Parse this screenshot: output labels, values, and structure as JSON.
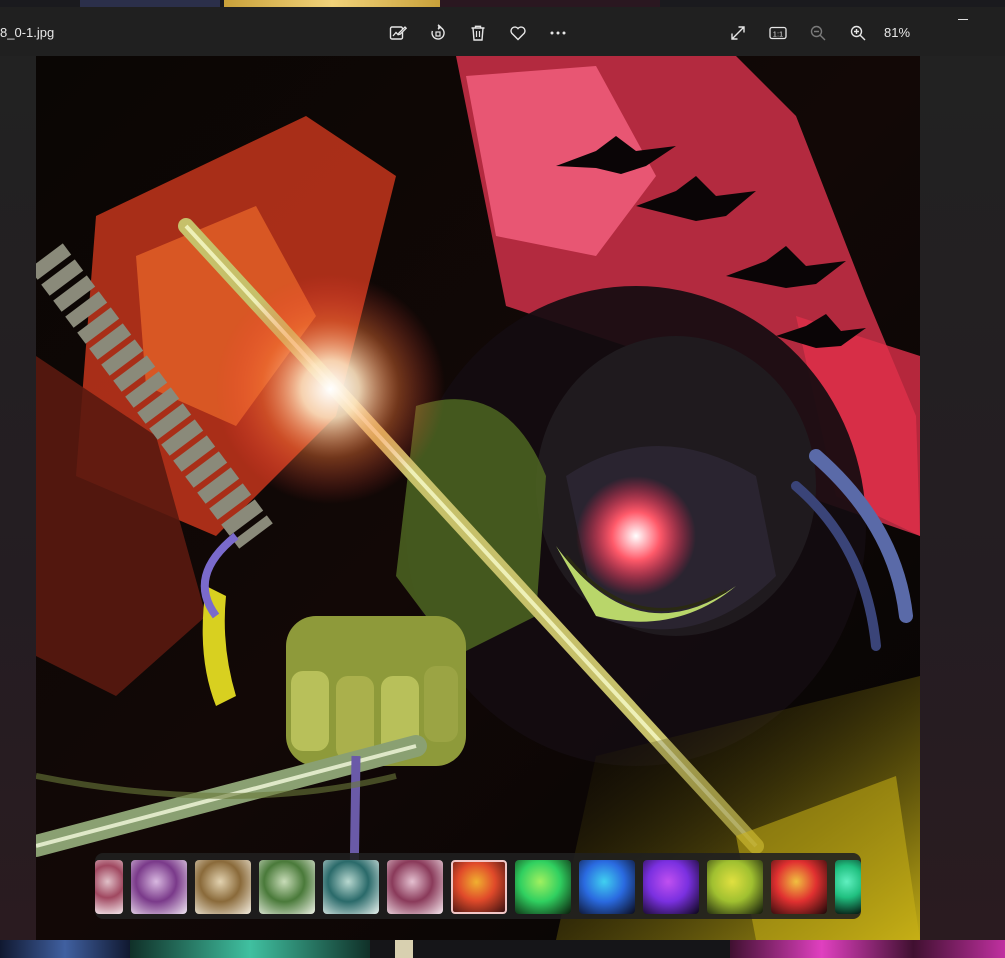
{
  "app": {
    "filename": "8_0-1.jpg",
    "zoom_level": "81%"
  },
  "toolbar": {
    "edit_icon": "edit-image-icon",
    "rotate_icon": "rotate-icon",
    "delete_icon": "delete-icon",
    "favorite_icon": "heart-icon",
    "more_icon": "more-icon",
    "fullscreen_icon": "expand-icon",
    "actual_size_icon": "actual-size-icon",
    "actual_size_label": "1:1",
    "zoom_out_icon": "zoom-out-icon",
    "zoom_in_icon": "zoom-in-icon"
  },
  "filmstrip": {
    "selected_index": 6,
    "thumbnails": [
      {
        "tone": "white-rose"
      },
      {
        "tone": "purple-white"
      },
      {
        "tone": "gold-white"
      },
      {
        "tone": "green-white"
      },
      {
        "tone": "teal-white"
      },
      {
        "tone": "pink-white"
      },
      {
        "tone": "red-orange"
      },
      {
        "tone": "green"
      },
      {
        "tone": "blue"
      },
      {
        "tone": "violet"
      },
      {
        "tone": "yellow-green"
      },
      {
        "tone": "red-gold"
      },
      {
        "tone": "green-cyan"
      }
    ]
  },
  "colors": {
    "window_bg": "#202020",
    "selected_thumb_border": "#f1c6c6"
  }
}
